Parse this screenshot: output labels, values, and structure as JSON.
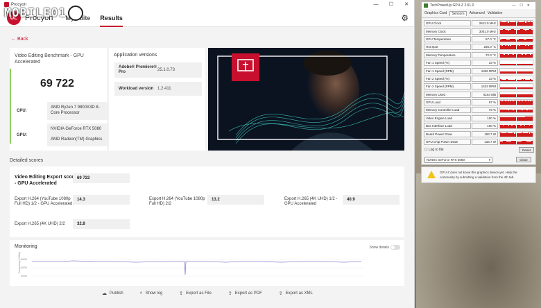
{
  "watermark": {
    "text": "MOBILE01"
  },
  "app": {
    "window_title": "Procyon",
    "brand": "Procyon",
    "logo_text": "UL",
    "nav": [
      "My suite",
      "Results"
    ],
    "back_label": "Back",
    "score_card": {
      "title": "Video Editing Benchmark - GPU Accelerated",
      "score": "69 722",
      "cpu_label": "CPU:",
      "cpu_value": "AMD Ryzen 7 9800X3D 8-Core Processor",
      "gpu_label": "GPU:",
      "gpu_value_1": "NVIDIA GeForce RTX 5080",
      "gpu_value_2": "AMD Radeon(TM) Graphics"
    },
    "versions": {
      "title": "Application versions",
      "rows": [
        {
          "key": "Adobe® Premiere® Pro",
          "value": "25.1.0.73"
        },
        {
          "key": "Workload version",
          "value": "1.2.411"
        }
      ]
    },
    "detailed": {
      "section_title": "Detailed scores",
      "main_label": "Video Editing Export score - GPU Accelerated",
      "main_value": "69 722",
      "items": [
        {
          "label": "Export H.264 (YouTube 1080p Full HD) 1/2 - GPU Accelerated",
          "value": "14.3"
        },
        {
          "label": "Export H.264 (YouTube 1080p Full HD) 2/2",
          "value": "13.2"
        },
        {
          "label": "Export H.265 (4K UHD) 1/2 - GPU Accelerated",
          "value": "40.9"
        },
        {
          "label": "Export H.265 (4K UHD) 2/2",
          "value": "32.8"
        }
      ]
    },
    "monitoring": {
      "title": "Monitoring",
      "toggle_label": "Show details",
      "show_details": false,
      "ylabel": "Frequency (MHz)",
      "ticks": [
        "4000",
        "3000",
        "2000"
      ],
      "line_color": "#8b7fd0"
    },
    "footer": [
      {
        "label": "Publish",
        "icon": "cloud-upload-icon"
      },
      {
        "label": "Show log",
        "icon": "search-icon"
      },
      {
        "label": "Export as File",
        "icon": "export-icon"
      },
      {
        "label": "Export as PDF",
        "icon": "export-icon"
      },
      {
        "label": "Export as XML",
        "icon": "export-icon"
      }
    ],
    "accent_color": "#c8102e"
  },
  "gpuz": {
    "window_title": "TechPowerUp GPU-Z 2.61.0",
    "tabs": [
      "Graphics Card",
      "Sensors",
      "Advanced",
      "Validation"
    ],
    "active_tab": "Sensors",
    "sensors": [
      {
        "name": "GPU Clock",
        "value": "2612.0 MHz",
        "level": 0.85
      },
      {
        "name": "Memory Clock",
        "value": "3001.0 MHz",
        "level": 0.9
      },
      {
        "name": "GPU Temperature",
        "value": "57.0 °C",
        "level": 0.55
      },
      {
        "name": "Hot Spot",
        "value": "255.0 °C",
        "level": 0.95
      },
      {
        "name": "Memory Temperature",
        "value": "72.0 °C",
        "level": 0.7
      },
      {
        "name": "Fan 1 Speed (%)",
        "value": "33 %",
        "level": 0.35
      },
      {
        "name": "Fan 1 Speed (RPM)",
        "value": "1326 RPM",
        "level": 0.4
      },
      {
        "name": "Fan 2 Speed (%)",
        "value": "33 %",
        "level": 0.35
      },
      {
        "name": "Fan 2 Speed (RPM)",
        "value": "1433 RPM",
        "level": 0.4
      },
      {
        "name": "Memory Used",
        "value": "6164 MB",
        "level": 0.6
      },
      {
        "name": "GPU Load",
        "value": "97 %",
        "level": 0.9
      },
      {
        "name": "Memory Controller Load",
        "value": "73 %",
        "level": 0.7
      },
      {
        "name": "Video Engine Load",
        "value": "100 %",
        "level": 0.85
      },
      {
        "name": "Bus Interface Load",
        "value": "100 %",
        "level": 0.8
      },
      {
        "name": "Board Power Draw",
        "value": "183.7 W",
        "level": 0.75
      },
      {
        "name": "GPU Chip Power Draw",
        "value": "133.7 W",
        "level": 0.7
      }
    ],
    "graph_color": "#d11a1a",
    "log_label": "Log to file",
    "reset_label": "Reset",
    "device": "NVIDIA GeForce RTX 5080",
    "close_label": "Close",
    "notice": "GPU-Z does not know this graphics device yet. Help the community by submitting a validation from the 4th tab."
  }
}
